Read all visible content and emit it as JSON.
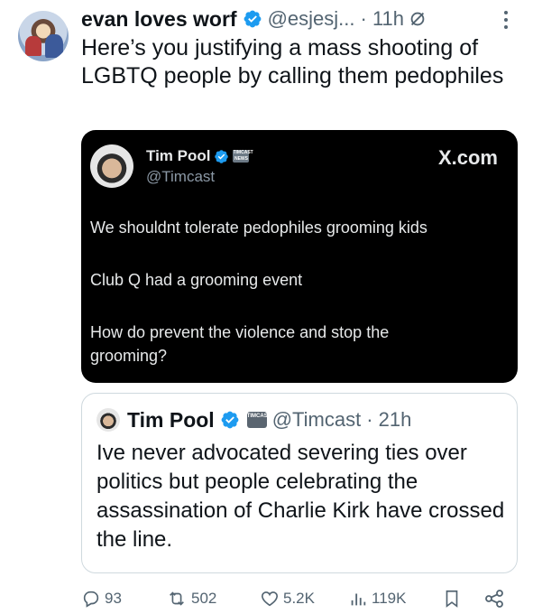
{
  "tweet": {
    "author_name": "evan loves worf",
    "author_handle": "@esjesj...",
    "time": "· 11h",
    "text": "Here’s you justifying a mass shooting of LGBTQ people by calling them pedophiles"
  },
  "media": {
    "author_name": "Tim Pool",
    "author_handle": "@Timcast",
    "site": "X.com",
    "badge": "TIMCAST NEWS",
    "lines": [
      "We shouldnt tolerate pedophiles grooming kids",
      "Club Q had a grooming event",
      "How do prevent the violence and stop the grooming?"
    ]
  },
  "quote": {
    "author_name": "Tim Pool",
    "author_handle": "@Timcast",
    "time": "· 21h",
    "badge": "TIMCAST NEWS",
    "text": "Ive never advocated severing ties over politics but people celebrating the assassination of Charlie Kirk have crossed the line."
  },
  "actions": {
    "replies": "93",
    "reposts": "502",
    "likes": "5.2K",
    "views": "119K"
  },
  "colors": {
    "verified": "#1d9bf0",
    "muted_text": "#536471",
    "border": "#cfd9de"
  }
}
